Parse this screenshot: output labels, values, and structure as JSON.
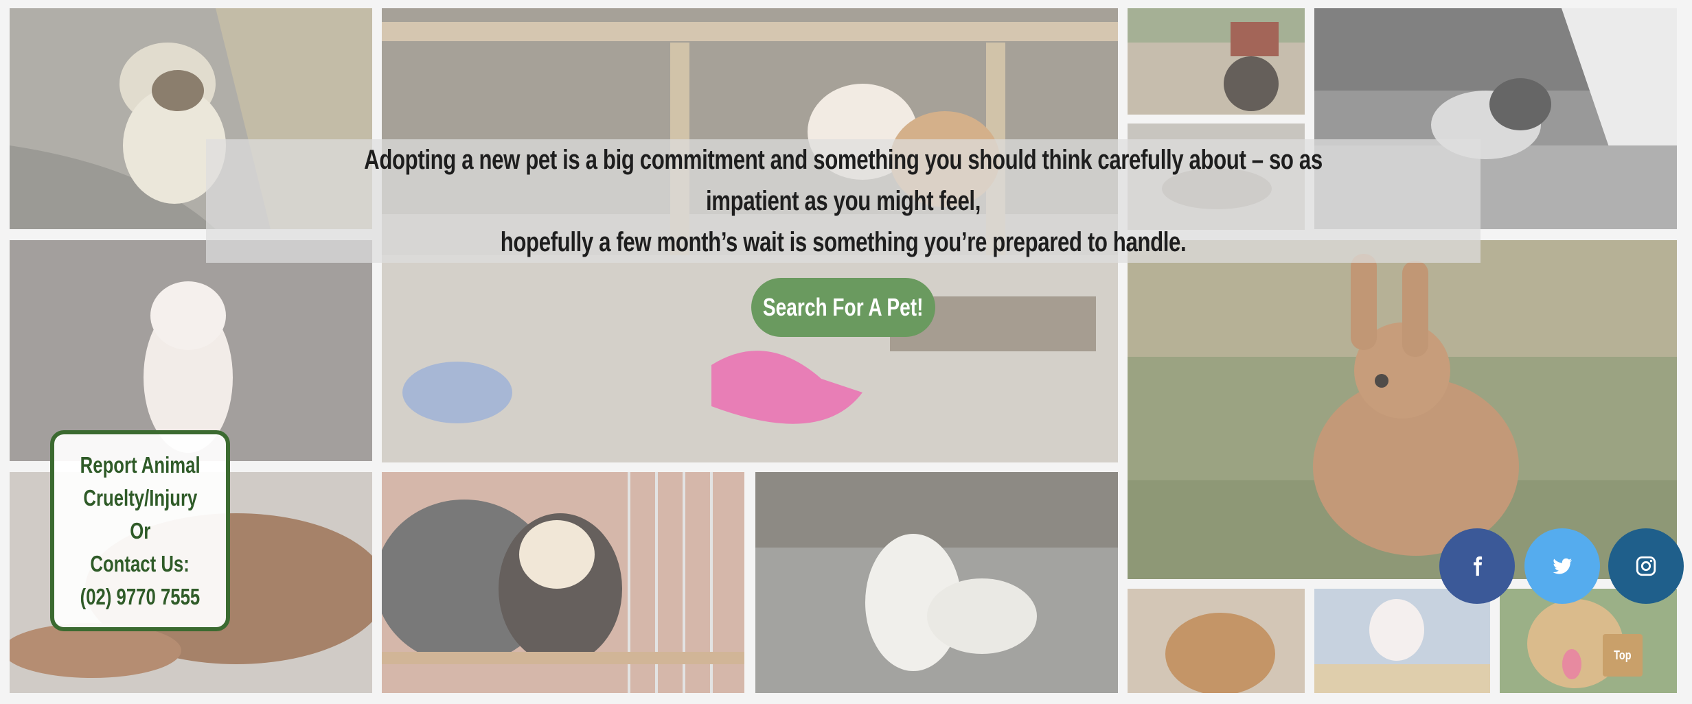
{
  "hero": {
    "quote_line1": "Adopting a new pet is a big commitment and something you should think carefully about – so as impatient as you might feel,",
    "quote_line2": "hopefully a few month’s wait is something you’re prepared to handle."
  },
  "search_button_label": "Search For A Pet!",
  "report_box": {
    "line1": "Report Animal",
    "line2": "Cruelty/Injury",
    "line3": "Or",
    "line4": "Contact Us:",
    "line5": "(02) 9770 7555"
  },
  "social": {
    "facebook_icon": "facebook-icon",
    "twitter_icon": "twitter-icon",
    "instagram_icon": "instagram-icon",
    "facebook_color": "#3b5998",
    "twitter_color": "#55acee",
    "instagram_color": "#1f5f8b"
  },
  "top_button_label": "Top",
  "photos": [
    "puppy-on-road",
    "puppies-under-bench",
    "motorbike",
    "cat-on-table",
    "spotted-dog-street",
    "white-puppy",
    "brown-rabbit",
    "sleeping-dog",
    "ferret-in-cage",
    "white-fluffy-dog",
    "guinea-pig",
    "white-rat",
    "happy-dog"
  ]
}
